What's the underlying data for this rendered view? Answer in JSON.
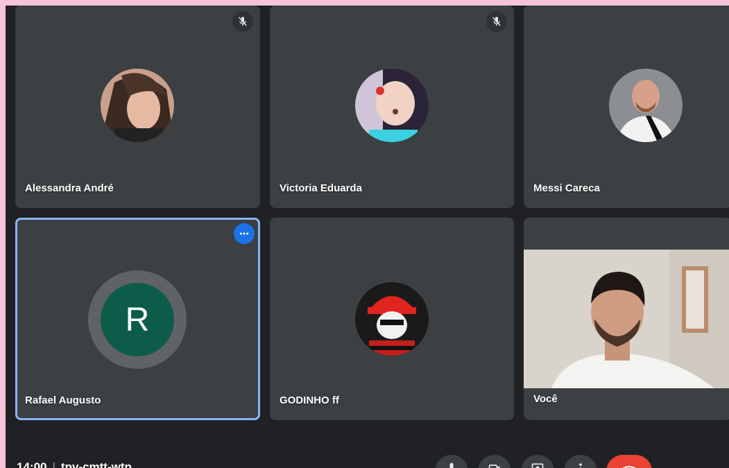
{
  "participants": [
    {
      "name": "Alessandra André",
      "muted": true
    },
    {
      "name": "Victoria Eduarda",
      "muted": true
    },
    {
      "name": "Messi Careca",
      "muted": false
    },
    {
      "name": "Rafael Augusto",
      "initial": "R",
      "avatar_color": "#0d5c4a",
      "selected": true
    },
    {
      "name": "GODINHO ff"
    },
    {
      "name": "Você",
      "video_on": true
    }
  ],
  "meeting": {
    "time": "14:00",
    "separator": "|",
    "code": "tpv-cmtt-wtp"
  },
  "controls": [
    "mic-icon",
    "camera-icon",
    "present-icon",
    "more-vert-icon",
    "end-call-icon"
  ],
  "colors": {
    "end_call": "#ea4335",
    "selected_border": "#8ab4f8",
    "more_button": "#1a73e8"
  }
}
